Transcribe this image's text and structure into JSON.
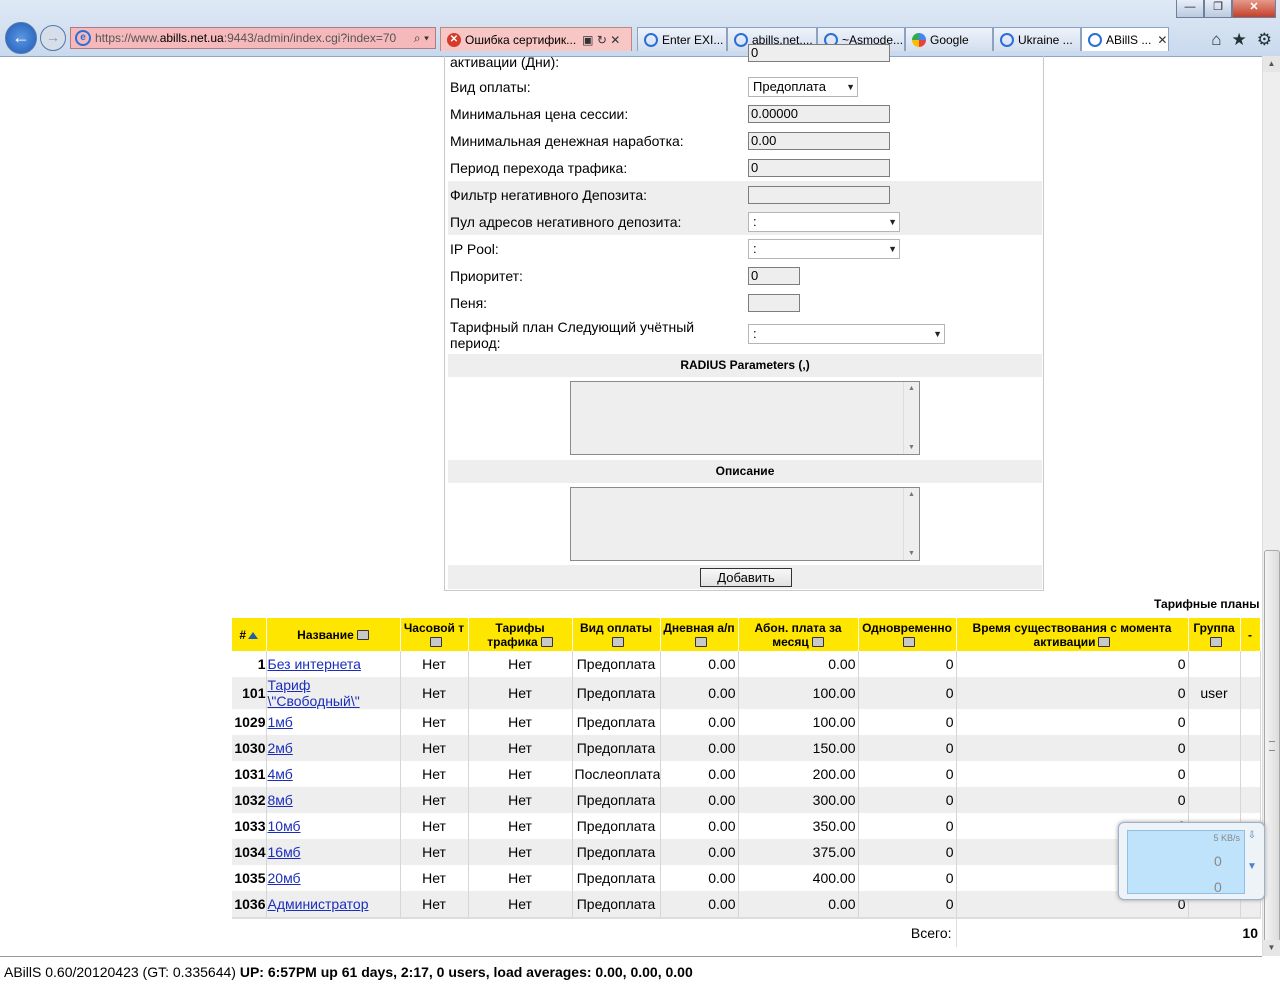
{
  "browser": {
    "address": {
      "prefix": "https://www.",
      "domain": "abills.net.ua",
      "suffix": ":9443/admin/index.cgi?index=70"
    },
    "cert_tab": "Ошибка сертифик...",
    "tabs": [
      "Enter EXI...",
      "abills.net....",
      "~Asmode...",
      "Google",
      "Ukraine ...",
      "ABillS ..."
    ],
    "window_controls": [
      "—",
      "❐",
      "✕"
    ],
    "toolbar_icons": [
      "⌂",
      "★",
      "⚙"
    ]
  },
  "form": {
    "top_partial_label": "активации (Дни):",
    "top_partial_value": "0",
    "fields": [
      {
        "label": "Вид оплаты:",
        "type": "select",
        "value": "Предоплата"
      },
      {
        "label": "Минимальная цена сессии:",
        "type": "input",
        "value": "0.00000"
      },
      {
        "label": "Минимальная денежная наработка:",
        "type": "input",
        "value": "0.00"
      },
      {
        "label": "Период перехода трафика:",
        "type": "input",
        "value": "0"
      },
      {
        "label": "Фильтр негативного Депозита:",
        "type": "input",
        "value": ""
      },
      {
        "label": "Пул адресов негативного депозита:",
        "type": "select",
        "value": ":"
      },
      {
        "label": "IP Pool:",
        "type": "select",
        "value": ":"
      },
      {
        "label": "Приоритет:",
        "type": "input",
        "value": "0"
      },
      {
        "label": "Пеня:",
        "type": "input",
        "value": ""
      },
      {
        "label": "Тарифный план Следующий учётный период:",
        "type": "select",
        "value": ":"
      }
    ],
    "radius_header": "RADIUS Parameters (,)",
    "desc_header": "Описание",
    "submit_label": "Добавить"
  },
  "table": {
    "caption": "Тарифные планы",
    "columns": [
      "#",
      "Название",
      "Часовой т",
      "Тарифы трафика",
      "Вид оплаты",
      "Дневная а/п",
      "Абон. плата за месяц",
      "Одновременно",
      "Время существования с момента активации",
      "Группа",
      "-"
    ],
    "rows": [
      {
        "id": "1",
        "name": "Без интернета",
        "hourly": "Нет",
        "traffic": "Нет",
        "payment": "Предоплата",
        "daily": "0.00",
        "monthly": "0.00",
        "simultaneous": "0",
        "lifetime": "0",
        "group": ""
      },
      {
        "id": "101",
        "name": "Тариф \\\"Свободный\\\"",
        "hourly": "Нет",
        "traffic": "Нет",
        "payment": "Предоплата",
        "daily": "0.00",
        "monthly": "100.00",
        "simultaneous": "0",
        "lifetime": "0",
        "group": "user"
      },
      {
        "id": "1029",
        "name": "1мб",
        "hourly": "Нет",
        "traffic": "Нет",
        "payment": "Предоплата",
        "daily": "0.00",
        "monthly": "100.00",
        "simultaneous": "0",
        "lifetime": "0",
        "group": ""
      },
      {
        "id": "1030",
        "name": "2мб",
        "hourly": "Нет",
        "traffic": "Нет",
        "payment": "Предоплата",
        "daily": "0.00",
        "monthly": "150.00",
        "simultaneous": "0",
        "lifetime": "0",
        "group": ""
      },
      {
        "id": "1031",
        "name": "4мб",
        "hourly": "Нет",
        "traffic": "Нет",
        "payment": "Послеоплата",
        "daily": "0.00",
        "monthly": "200.00",
        "simultaneous": "0",
        "lifetime": "0",
        "group": ""
      },
      {
        "id": "1032",
        "name": "8мб",
        "hourly": "Нет",
        "traffic": "Нет",
        "payment": "Предоплата",
        "daily": "0.00",
        "monthly": "300.00",
        "simultaneous": "0",
        "lifetime": "0",
        "group": ""
      },
      {
        "id": "1033",
        "name": "10мб",
        "hourly": "Нет",
        "traffic": "Нет",
        "payment": "Предоплата",
        "daily": "0.00",
        "monthly": "350.00",
        "simultaneous": "0",
        "lifetime": "0",
        "group": ""
      },
      {
        "id": "1034",
        "name": "16мб",
        "hourly": "Нет",
        "traffic": "Нет",
        "payment": "Предоплата",
        "daily": "0.00",
        "monthly": "375.00",
        "simultaneous": "0",
        "lifetime": "0",
        "group": ""
      },
      {
        "id": "1035",
        "name": "20мб",
        "hourly": "Нет",
        "traffic": "Нет",
        "payment": "Предоплата",
        "daily": "0.00",
        "monthly": "400.00",
        "simultaneous": "0",
        "lifetime": "0",
        "group": ""
      },
      {
        "id": "1036",
        "name": "Администратор",
        "hourly": "Нет",
        "traffic": "Нет",
        "payment": "Предоплата",
        "daily": "0.00",
        "monthly": "0.00",
        "simultaneous": "0",
        "lifetime": "0",
        "group": ""
      }
    ],
    "total_label": "Всего:",
    "total_value": "10"
  },
  "net_widget": {
    "speed": "5 KB/s",
    "down": "0",
    "up": "0"
  },
  "footer": {
    "version": "ABillS 0.60/20120423 (GT: 0.335644)",
    "uptime": "UP: 6:57PM up 61 days, 2:17, 0 users, load averages: 0.00, 0.00, 0.00"
  }
}
